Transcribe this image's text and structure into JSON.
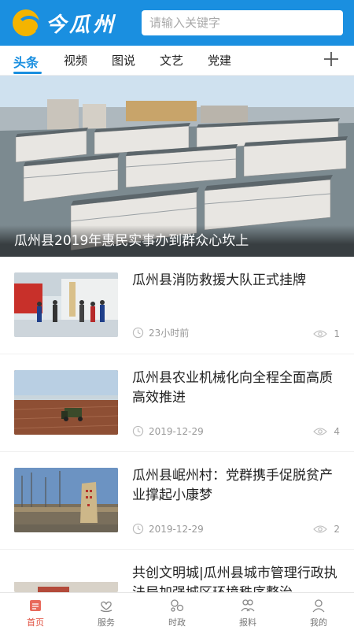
{
  "header": {
    "logo_text": "今瓜州",
    "search_placeholder": "请输入关键字",
    "brand_color": "#1a8fe0"
  },
  "tabs": [
    {
      "label": "头条",
      "active": true
    },
    {
      "label": "视频",
      "active": false
    },
    {
      "label": "图说",
      "active": false
    },
    {
      "label": "文艺",
      "active": false
    },
    {
      "label": "党建",
      "active": false
    }
  ],
  "tabs_add_icon": "plus-icon",
  "hero": {
    "caption": "瓜州县2019年惠民实事办到群众心坎上"
  },
  "news": [
    {
      "title": "瓜州县消防救援大队正式挂牌",
      "time": "23小时前",
      "views": "1",
      "thumb": "fire-brigade-photo"
    },
    {
      "title": "瓜州县农业机械化向全程全面高质高效推进",
      "time": "2019-12-29",
      "views": "4",
      "thumb": "farm-field-photo"
    },
    {
      "title": "瓜州县岷州村：党群携手促脱贫产业撑起小康梦",
      "time": "2019-12-29",
      "views": "2",
      "thumb": "village-stone-photo"
    },
    {
      "title": "共创文明城|瓜州县城市管理行政执法局加强城区环境秩序整治",
      "time": "",
      "views": "",
      "thumb": "city-photo"
    }
  ],
  "bottom_nav": [
    {
      "label": "首页",
      "icon": "home-icon",
      "active": true
    },
    {
      "label": "服务",
      "icon": "heart-hand-icon",
      "active": false
    },
    {
      "label": "时政",
      "icon": "bubbles-icon",
      "active": false
    },
    {
      "label": "报料",
      "icon": "people-icon",
      "active": false
    },
    {
      "label": "我的",
      "icon": "user-icon",
      "active": false
    }
  ],
  "colors": {
    "active_tab": "#1a8fe0",
    "active_nav": "#e05040",
    "meta_text": "#999999"
  }
}
